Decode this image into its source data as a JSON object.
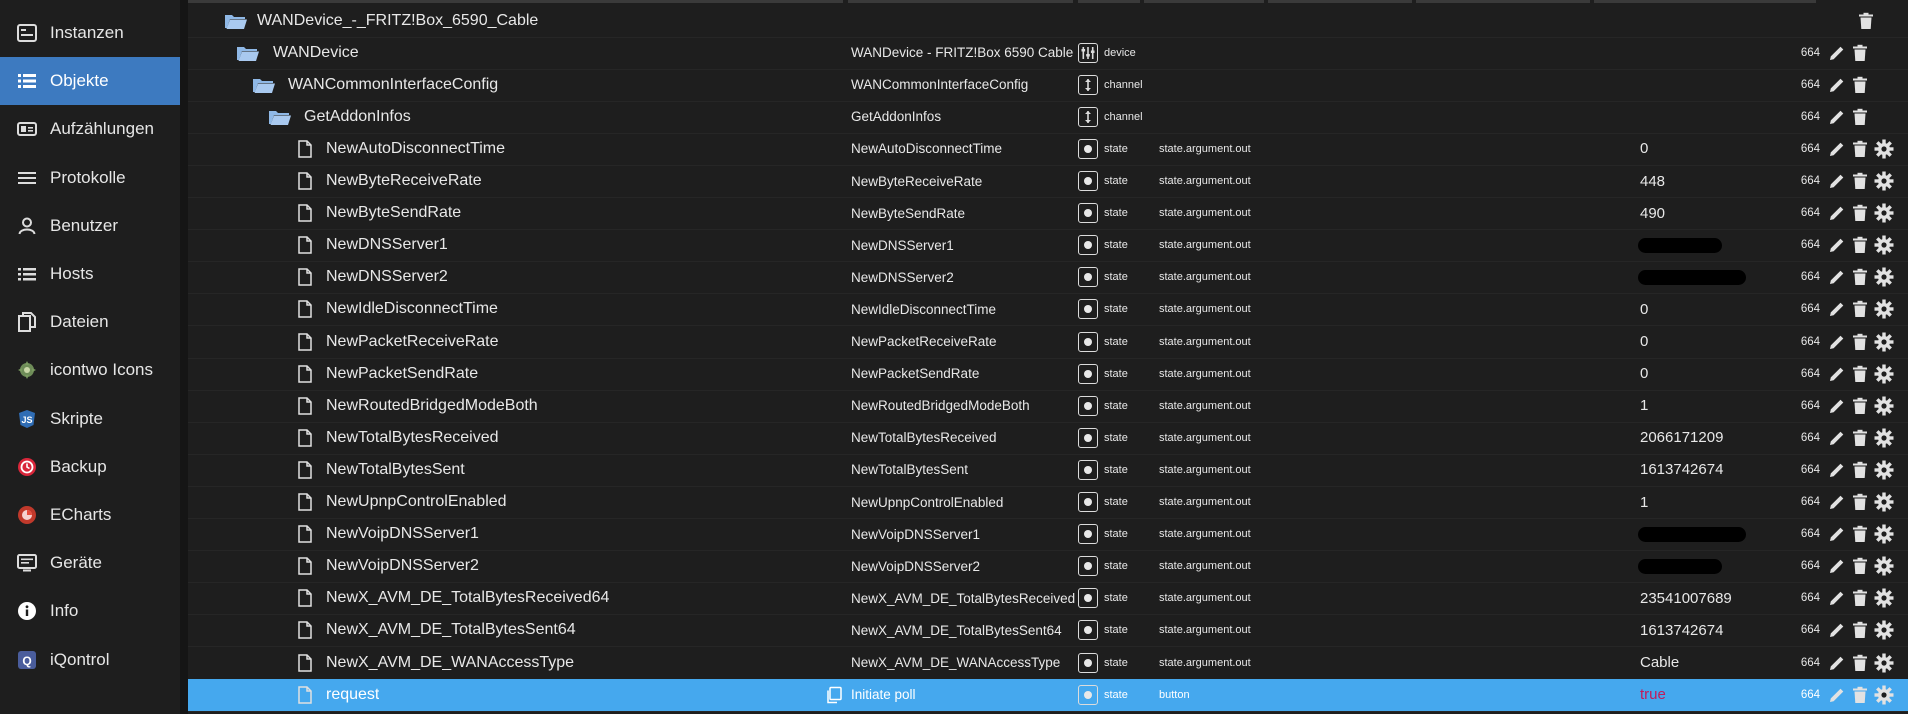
{
  "sidebar": {
    "items": [
      {
        "label": "Instanzen",
        "icon": "instances-icon",
        "active": false
      },
      {
        "label": "Objekte",
        "icon": "list-icon",
        "active": true
      },
      {
        "label": "Aufzählungen",
        "icon": "enums-icon",
        "active": false
      },
      {
        "label": "Protokolle",
        "icon": "logs-icon",
        "active": false
      },
      {
        "label": "Benutzer",
        "icon": "user-icon",
        "active": false
      },
      {
        "label": "Hosts",
        "icon": "hosts-icon",
        "active": false
      },
      {
        "label": "Dateien",
        "icon": "files-icon",
        "active": false
      },
      {
        "label": "icontwo Icons",
        "icon": "icontwo-icon",
        "active": false
      },
      {
        "label": "Skripte",
        "icon": "js-icon",
        "active": false
      },
      {
        "label": "Backup",
        "icon": "backup-icon",
        "active": false
      },
      {
        "label": "ECharts",
        "icon": "echarts-icon",
        "active": false
      },
      {
        "label": "Geräte",
        "icon": "devices-icon",
        "active": false
      },
      {
        "label": "Info",
        "icon": "info-icon",
        "active": false
      },
      {
        "label": "iQontrol",
        "icon": "iqontrol-icon",
        "active": false
      }
    ]
  },
  "rows": [
    {
      "name": "WANDevice_-_FRITZ!Box_6590_Cable",
      "kind": "folder",
      "level": 0,
      "dname": "",
      "type": "",
      "role": "",
      "value": "",
      "acl": "",
      "actions": "trash"
    },
    {
      "name": "WANDevice",
      "kind": "folder",
      "level": 1,
      "dname": "WANDevice - FRITZ!Box 6590 Cable",
      "type": "device",
      "role": "",
      "value": "",
      "acl": "664",
      "actions": "edit-trash"
    },
    {
      "name": "WANCommonInterfaceConfig",
      "kind": "folder",
      "level": 2,
      "dname": "WANCommonInterfaceConfig",
      "type": "channel",
      "role": "",
      "value": "",
      "acl": "664",
      "actions": "edit-trash"
    },
    {
      "name": "GetAddonInfos",
      "kind": "folder",
      "level": 3,
      "dname": "GetAddonInfos",
      "type": "channel",
      "role": "",
      "value": "",
      "acl": "664",
      "actions": "edit-trash"
    },
    {
      "name": "NewAutoDisconnectTime",
      "kind": "file",
      "level": 4,
      "dname": "NewAutoDisconnectTime",
      "type": "state",
      "role": "state.argument.out",
      "value": "0",
      "acl": "664",
      "actions": "all"
    },
    {
      "name": "NewByteReceiveRate",
      "kind": "file",
      "level": 4,
      "dname": "NewByteReceiveRate",
      "type": "state",
      "role": "state.argument.out",
      "value": "448",
      "acl": "664",
      "actions": "all"
    },
    {
      "name": "NewByteSendRate",
      "kind": "file",
      "level": 4,
      "dname": "NewByteSendRate",
      "type": "state",
      "role": "state.argument.out",
      "value": "490",
      "acl": "664",
      "actions": "all"
    },
    {
      "name": "NewDNSServer1",
      "kind": "file",
      "level": 4,
      "dname": "NewDNSServer1",
      "type": "state",
      "role": "state.argument.out",
      "value": "",
      "redacted": true,
      "acl": "664",
      "actions": "all"
    },
    {
      "name": "NewDNSServer2",
      "kind": "file",
      "level": 4,
      "dname": "NewDNSServer2",
      "type": "state",
      "role": "state.argument.out",
      "value": "",
      "redacted": true,
      "acl": "664",
      "actions": "all"
    },
    {
      "name": "NewIdleDisconnectTime",
      "kind": "file",
      "level": 4,
      "dname": "NewIdleDisconnectTime",
      "type": "state",
      "role": "state.argument.out",
      "value": "0",
      "acl": "664",
      "actions": "all"
    },
    {
      "name": "NewPacketReceiveRate",
      "kind": "file",
      "level": 4,
      "dname": "NewPacketReceiveRate",
      "type": "state",
      "role": "state.argument.out",
      "value": "0",
      "acl": "664",
      "actions": "all"
    },
    {
      "name": "NewPacketSendRate",
      "kind": "file",
      "level": 4,
      "dname": "NewPacketSendRate",
      "type": "state",
      "role": "state.argument.out",
      "value": "0",
      "acl": "664",
      "actions": "all"
    },
    {
      "name": "NewRoutedBridgedModeBoth",
      "kind": "file",
      "level": 4,
      "dname": "NewRoutedBridgedModeBoth",
      "type": "state",
      "role": "state.argument.out",
      "value": "1",
      "acl": "664",
      "actions": "all"
    },
    {
      "name": "NewTotalBytesReceived",
      "kind": "file",
      "level": 4,
      "dname": "NewTotalBytesReceived",
      "type": "state",
      "role": "state.argument.out",
      "value": "2066171209",
      "acl": "664",
      "actions": "all"
    },
    {
      "name": "NewTotalBytesSent",
      "kind": "file",
      "level": 4,
      "dname": "NewTotalBytesSent",
      "type": "state",
      "role": "state.argument.out",
      "value": "1613742674",
      "acl": "664",
      "actions": "all"
    },
    {
      "name": "NewUpnpControlEnabled",
      "kind": "file",
      "level": 4,
      "dname": "NewUpnpControlEnabled",
      "type": "state",
      "role": "state.argument.out",
      "value": "1",
      "acl": "664",
      "actions": "all"
    },
    {
      "name": "NewVoipDNSServer1",
      "kind": "file",
      "level": 4,
      "dname": "NewVoipDNSServer1",
      "type": "state",
      "role": "state.argument.out",
      "value": "",
      "redacted": true,
      "acl": "664",
      "actions": "all"
    },
    {
      "name": "NewVoipDNSServer2",
      "kind": "file",
      "level": 4,
      "dname": "NewVoipDNSServer2",
      "type": "state",
      "role": "state.argument.out",
      "value": "",
      "redacted": true,
      "acl": "664",
      "actions": "all"
    },
    {
      "name": "NewX_AVM_DE_TotalBytesReceived64",
      "kind": "file",
      "level": 4,
      "dname": "NewX_AVM_DE_TotalBytesReceived…",
      "type": "state",
      "role": "state.argument.out",
      "value": "23541007689",
      "acl": "664",
      "actions": "all"
    },
    {
      "name": "NewX_AVM_DE_TotalBytesSent64",
      "kind": "file",
      "level": 4,
      "dname": "NewX_AVM_DE_TotalBytesSent64",
      "type": "state",
      "role": "state.argument.out",
      "value": "1613742674",
      "acl": "664",
      "actions": "all"
    },
    {
      "name": "NewX_AVM_DE_WANAccessType",
      "kind": "file",
      "level": 4,
      "dname": "NewX_AVM_DE_WANAccessType",
      "type": "state",
      "role": "state.argument.out",
      "value": "Cable",
      "acl": "664",
      "actions": "all"
    },
    {
      "name": "request",
      "kind": "file",
      "level": 4,
      "dname": "Initiate poll",
      "type": "state",
      "role": "button",
      "value": "true",
      "acl": "664",
      "actions": "all",
      "selected": true
    }
  ],
  "colors": {
    "accent": "#3d7ac0",
    "selected_row": "#45a8ee",
    "true_value": "#c11b5c",
    "folder": "#8fb8e6"
  }
}
